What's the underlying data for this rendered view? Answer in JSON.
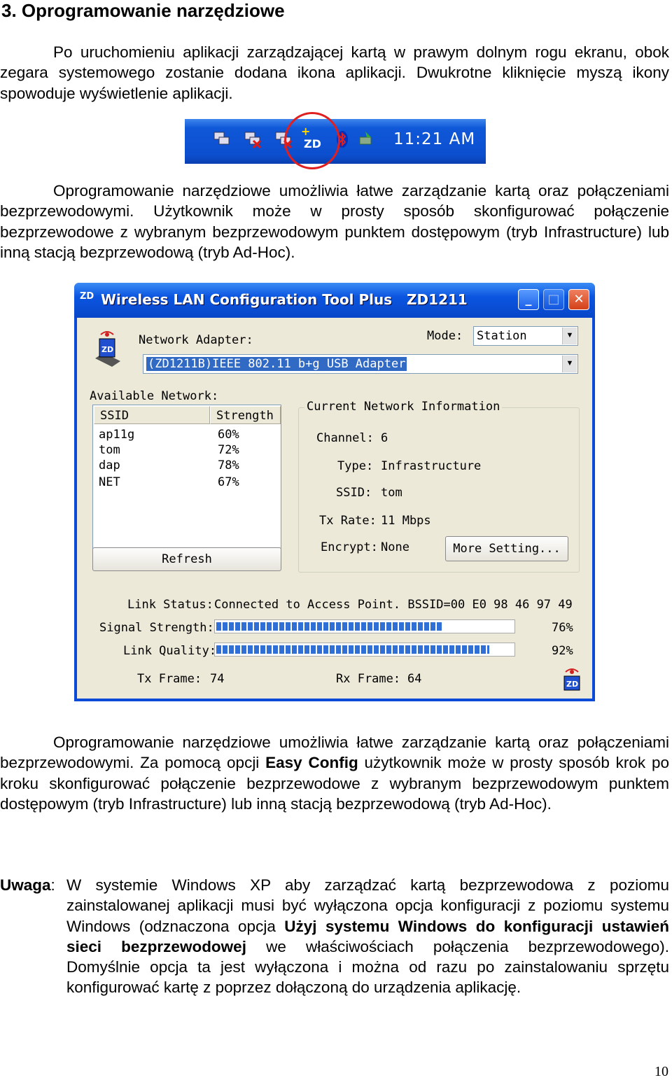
{
  "heading": "3. Oprogramowanie narzędziowe",
  "para1": "Po uruchomieniu aplikacji zarządzającej kartą w prawym dolnym rogu ekranu, obok zegara systemowego zostanie dodana ikona aplikacji. Dwukrotne kliknięcie myszą ikony spowoduje wyświetlenie aplikacji.",
  "tray": {
    "clock": "11:21 AM",
    "zd_label": "ZD"
  },
  "para2": "Oprogramowanie narzędziowe umożliwia łatwe zarządzanie kartą oraz połączeniami bezprzewodowymi. Użytkownik może w prosty sposób skonfigurować połączenie bezprzewodowe z wybranym bezprzewodowym punktem dostępowym (tryb Infrastructure) lub inną stacją bezprzewodową (tryb Ad-Hoc).",
  "app": {
    "title": "Wireless LAN Configuration Tool Plus",
    "model": "ZD1211",
    "network_adapter_label": "Network Adapter:",
    "mode_label": "Mode:",
    "mode_value": "Station",
    "adapter_value": "(ZD1211B)IEEE 802.11 b+g USB Adapter",
    "available_label": "Available Network:",
    "col_ssid": "SSID",
    "col_strength": "Strength",
    "networks": [
      {
        "ssid": "ap11g",
        "strength": "60%"
      },
      {
        "ssid": "tom",
        "strength": "72%"
      },
      {
        "ssid": "dap",
        "strength": "78%"
      },
      {
        "ssid": "NET",
        "strength": "67%"
      }
    ],
    "refresh": "Refresh",
    "current_label": "Current Network Information",
    "channel_label": "Channel:",
    "channel": "6",
    "type_label": "Type:",
    "type": "Infrastructure",
    "ssid_label": "SSID:",
    "ssid": "tom",
    "txrate_label": "Tx Rate:",
    "txrate": "11 Mbps",
    "encrypt_label": "Encrypt:",
    "encrypt": "None",
    "more_setting": "More Setting...",
    "link_status_label": "Link Status:",
    "link_status": "Connected to Access Point. BSSID=00 E0 98 46 97 49",
    "signal_label": "Signal Strength:",
    "signal_pct": "76%",
    "signal_value": 0.76,
    "quality_label": "Link Quality:",
    "quality_pct": "92%",
    "quality_value": 0.92,
    "txframe_label": "Tx Frame:",
    "txframe": "74",
    "rxframe_label": "Rx Frame:",
    "rxframe": "64"
  },
  "para3_a": "Oprogramowanie narzędziowe umożliwia łatwe zarządzanie kartą oraz połączeniami bezprzewodowymi. Za pomocą opcji ",
  "para3_b": "Easy Config",
  "para3_c": " użytkownik może w prosty sposób krok po kroku skonfigurować połączenie bezprzewodowe z wybranym bezprzewodowym punktem dostępowym (tryb Infrastructure) lub inną stacją bezprzewodową (tryb Ad-Hoc).",
  "note_label": "Uwaga",
  "note_a": "W systemie Windows XP aby zarządzać kartą bezprzewodowa z poziomu zainstalowanej aplikacji musi być wyłączona opcja konfiguracji z poziomu systemu Windows (odznaczona opcja ",
  "note_b": "Użyj systemu Windows do konfiguracji ustawień sieci bezprzewodowej",
  "note_c": " we właściwościach połączenia bezprzewodowego). Domyślnie opcja ta jest wyłączona i można od razu po zainstalowaniu sprzętu konfigurować kartę z poprzez dołączoną do urządzenia aplikację.",
  "page_number": "10"
}
